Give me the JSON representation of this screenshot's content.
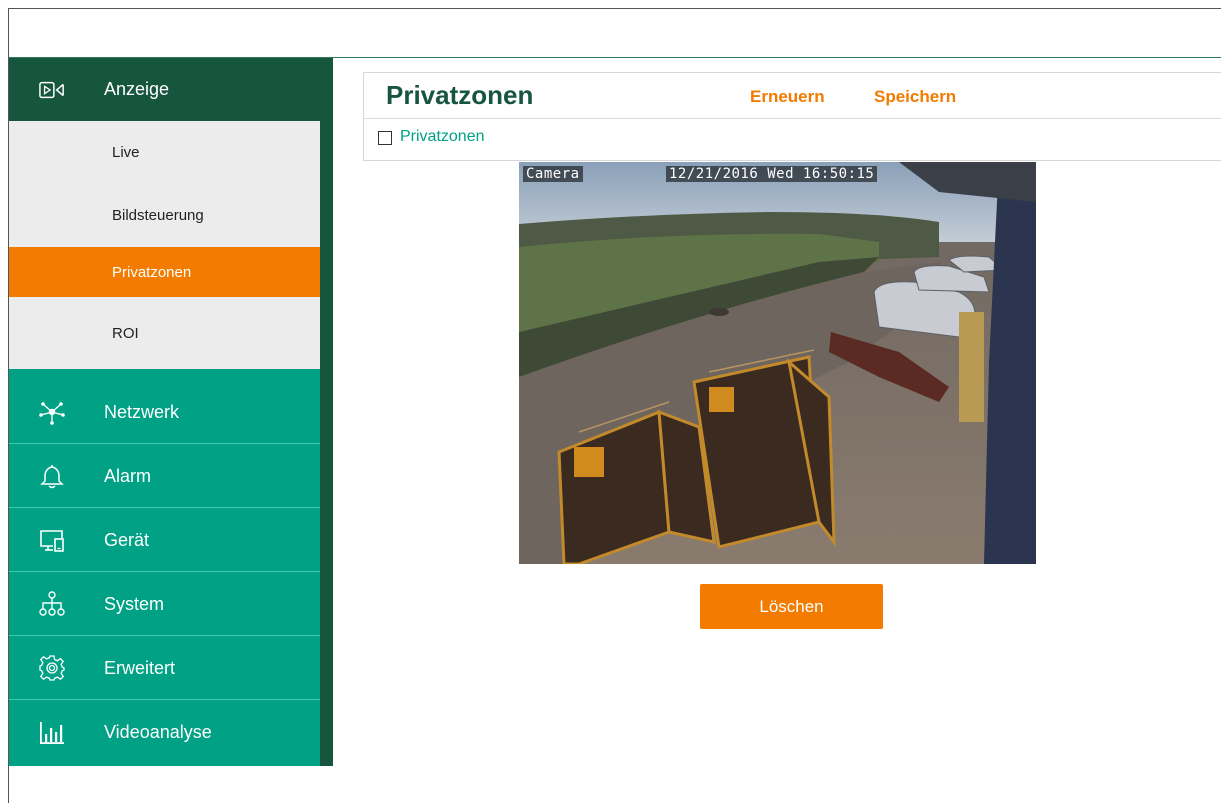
{
  "sidebar": {
    "sections": [
      {
        "label": "Anzeige",
        "icon": "display-icon"
      },
      {
        "label": "Netzwerk",
        "icon": "network-icon"
      },
      {
        "label": "Alarm",
        "icon": "bell-icon"
      },
      {
        "label": "Gerät",
        "icon": "device-icon"
      },
      {
        "label": "System",
        "icon": "hierarchy-icon"
      },
      {
        "label": "Erweitert",
        "icon": "gear-icon"
      },
      {
        "label": "Videoanalyse",
        "icon": "bar-chart-icon"
      }
    ],
    "sub_items": [
      "Live",
      "Bildsteuerung",
      "Privatzonen",
      "ROI"
    ],
    "selected_sub_item": "Privatzonen"
  },
  "panel": {
    "title": "Privatzonen",
    "refresh_label": "Erneuern",
    "save_label": "Speichern",
    "checkbox_label": "Privatzonen",
    "checkbox_checked": false
  },
  "camera": {
    "osd_name": "Camera",
    "osd_timestamp": "12/21/2016 Wed 16:50:15"
  },
  "delete_button_label": "Löschen",
  "colors": {
    "teal": "#00a185",
    "dark_green": "#17563e",
    "orange": "#f27b00",
    "submenu_bg": "#ececec"
  }
}
